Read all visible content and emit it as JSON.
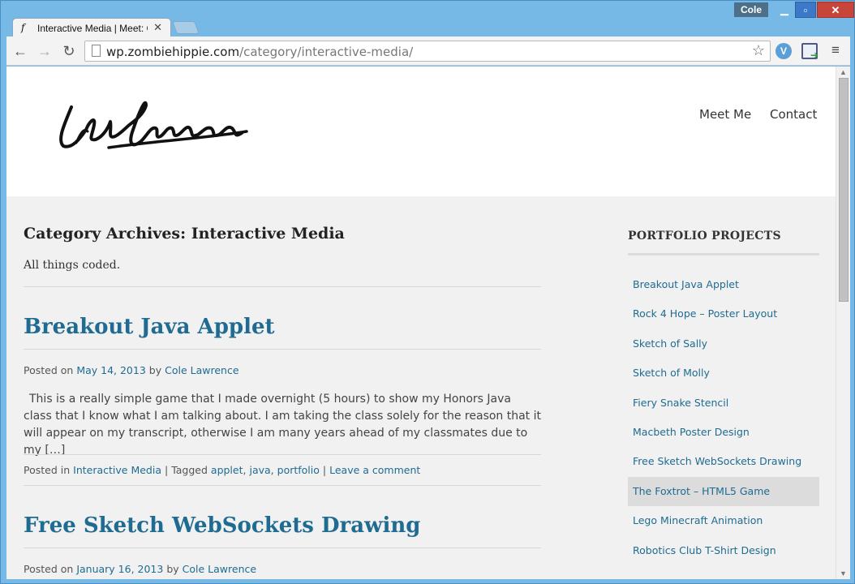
{
  "browser": {
    "tab_title": "Interactive Media | Meet: C",
    "tab_favicon": "f",
    "tab_close": "✕",
    "profile_name": "Cole",
    "url_host": "wp.zombiehippie.com",
    "url_path": "/category/interactive-media/",
    "icons": [
      "back-arrow-icon",
      "forward-arrow-icon",
      "reload-icon",
      "page-icon",
      "bookmark-star-icon",
      "extension-v-icon",
      "extension-cast-icon",
      "menu-icon"
    ]
  },
  "site": {
    "nav": {
      "meet_me": "Meet Me",
      "contact": "Contact"
    }
  },
  "archive": {
    "title": "Category Archives: Interactive Media",
    "description": "All things coded."
  },
  "posts": [
    {
      "title": "Breakout Java Applet",
      "posted_on_label": "Posted on",
      "date": "May 14, 2013",
      "by_label": "by",
      "author": "Cole Lawrence",
      "excerpt": "This is a really simple game  that I made overnight (5 hours) to show my Honors Java class that I know what I am talking about. I am taking the class solely for the reason that it will appear on my transcript, otherwise I am many years ahead of my classmates due to my […]",
      "posted_in_label": "Posted in",
      "category": "Interactive Media",
      "tagged_label": "Tagged",
      "tags": [
        "applet",
        "java",
        "portfolio"
      ],
      "comment_link": "Leave a comment"
    },
    {
      "title": "Free Sketch WebSockets Drawing",
      "posted_on_label": "Posted on",
      "date": "January 16, 2013",
      "by_label": "by",
      "author": "Cole Lawrence"
    }
  ],
  "sidebar": {
    "title": "PORTFOLIO PROJECTS",
    "items": [
      "Breakout Java Applet",
      "Rock 4 Hope – Poster Layout",
      "Sketch of Sally",
      "Sketch of Molly",
      "Fiery Snake Stencil",
      "Macbeth Poster Design",
      "Free Sketch WebSockets Drawing",
      "The Foxtrot – HTML5 Game",
      "Lego Minecraft Animation",
      "Robotics Club T-Shirt Design"
    ],
    "active_index": 7
  }
}
